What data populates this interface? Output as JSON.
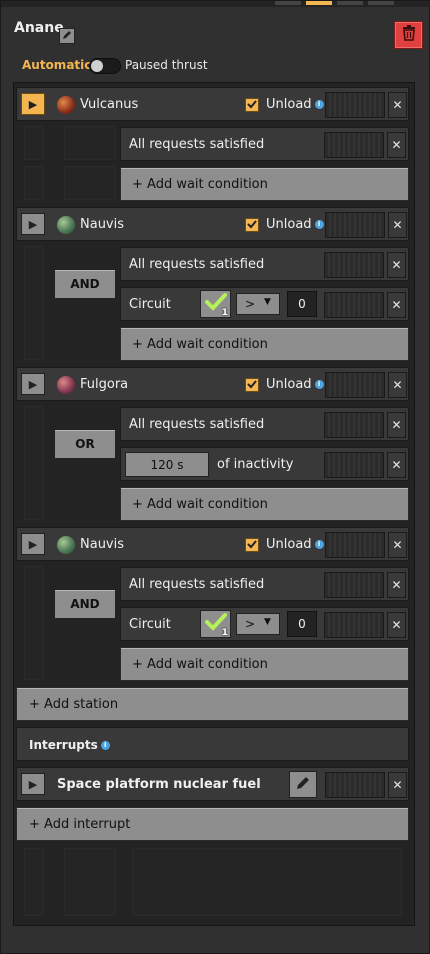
{
  "window": {
    "title": "Anane",
    "rename_icon": "pencil-icon",
    "delete_icon": "trash-icon",
    "accent": "#f3b651",
    "delete_color": "#e23f3f"
  },
  "mode": {
    "automatic_label": "Automatic",
    "paused_label": "Paused thrust",
    "toggle_on": false
  },
  "stations": [
    {
      "name": "Vulcanus",
      "active": true,
      "unload_label": "Unload",
      "unload_checked": true,
      "conditions": [
        {
          "type": "requests",
          "label": "All requests satisfied"
        }
      ],
      "add_condition_label": "+ Add wait condition"
    },
    {
      "name": "Nauvis",
      "active": false,
      "unload_label": "Unload",
      "unload_checked": true,
      "logic": "AND",
      "conditions": [
        {
          "type": "requests",
          "label": "All requests satisfied"
        },
        {
          "type": "circuit",
          "label": "Circuit",
          "signal_count": "1",
          "comparator": ">",
          "constant": "0"
        }
      ],
      "add_condition_label": "+ Add wait condition"
    },
    {
      "name": "Fulgora",
      "active": false,
      "unload_label": "Unload",
      "unload_checked": true,
      "logic": "OR",
      "conditions": [
        {
          "type": "requests",
          "label": "All requests satisfied"
        },
        {
          "type": "inactivity",
          "time": "120 s",
          "label": "of inactivity"
        }
      ],
      "add_condition_label": "+ Add wait condition"
    },
    {
      "name": "Nauvis",
      "active": false,
      "unload_label": "Unload",
      "unload_checked": true,
      "logic": "AND",
      "conditions": [
        {
          "type": "requests",
          "label": "All requests satisfied"
        },
        {
          "type": "circuit",
          "label": "Circuit",
          "signal_count": "1",
          "comparator": ">",
          "constant": "0"
        }
      ],
      "add_condition_label": "+ Add wait condition"
    }
  ],
  "add_station_label": "+ Add station",
  "interrupts": {
    "heading": "Interrupts",
    "items": [
      {
        "name": "Space platform nuclear fuel"
      }
    ],
    "add_label": "+ Add interrupt"
  },
  "icons": {
    "play": "play-icon",
    "close": "close-icon",
    "info": "info-icon",
    "check": "checkmark-icon",
    "edit": "pencil-icon"
  }
}
